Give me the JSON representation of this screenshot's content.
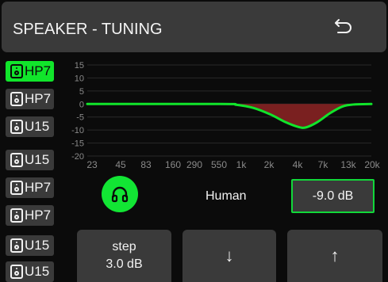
{
  "header": {
    "title": "SPEAKER - TUNING",
    "back_icon": "undo-arrow-icon"
  },
  "speakers": [
    {
      "label": "HP7",
      "active": true
    },
    {
      "label": "HP7",
      "active": false
    },
    {
      "label": "U15",
      "active": false
    },
    {
      "label": "U15",
      "active": false
    },
    {
      "label": "HP7",
      "active": false
    },
    {
      "label": "HP7",
      "active": false
    },
    {
      "label": "U15",
      "active": false
    },
    {
      "label": "U15",
      "active": false
    }
  ],
  "colors": {
    "accent": "#11e52b",
    "panel": "#3a3a3a",
    "curve_fill": "#7a2020",
    "background": "#0b0b0b"
  },
  "chart_data": {
    "type": "line",
    "y_ticks": [
      "15",
      "10",
      "5",
      "0",
      "-5",
      "-10",
      "-15",
      "-20"
    ],
    "x_ticks": [
      "23",
      "45",
      "83",
      "160",
      "290",
      "550",
      "1k",
      "2k",
      "4k",
      "7k",
      "13k",
      "20k"
    ],
    "ylim": [
      -20,
      15
    ],
    "x_log": true,
    "grid": true,
    "curve": {
      "freq": [
        23,
        550,
        800,
        1200,
        1800,
        2600,
        3500,
        4200,
        5500,
        7500,
        10000,
        13000,
        20000
      ],
      "db": [
        0,
        0,
        -0.3,
        -1.5,
        -4,
        -7,
        -8.8,
        -9,
        -7,
        -3.5,
        -1,
        -0.2,
        0
      ]
    }
  },
  "headphone_button": {
    "icon": "headphones-icon"
  },
  "mode_label": "Human",
  "gain_value": "-9.0 dB",
  "step_button": {
    "line1": "step",
    "line2": "3.0 dB"
  },
  "down_button": {
    "label": "↓"
  },
  "up_button": {
    "label": "↑"
  }
}
